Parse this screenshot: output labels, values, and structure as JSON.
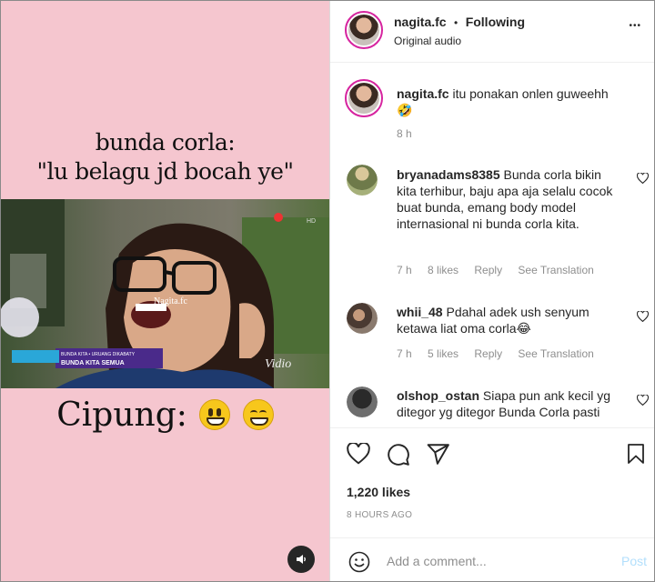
{
  "media": {
    "caption_top_line1": "bunda corla:",
    "caption_top_line2": "\"lu belagu jd bocah ye\"",
    "caption_bottom": "Cipung:",
    "watermark": "Nagita.fc",
    "vidio_logo": "Vidio",
    "banner_line1": "BUNDA KITA SEMUA",
    "channel_tag": "HD"
  },
  "header": {
    "username": "nagita.fc",
    "separator": "•",
    "follow_status": "Following",
    "audio": "Original audio",
    "more": "•••"
  },
  "comments": [
    {
      "username": "nagita.fc",
      "text": "itu ponakan onlen guweehh",
      "emoji": "🤣",
      "time": "8 h"
    },
    {
      "username": "bryanadams8385",
      "text": "Bunda corla bikin kita terhibur, baju apa aja selalu cocok buat bunda, emang body model internasional ni bunda corla kita.",
      "time": "7 h",
      "likes": "8 likes",
      "reply": "Reply",
      "translate": "See Translation"
    },
    {
      "username": "whii_48",
      "text": "Pdahal adek ush senyum ketawa liat oma corla😂",
      "time": "7 h",
      "likes": "5 likes",
      "reply": "Reply",
      "translate": "See Translation"
    },
    {
      "username": "olshop_ostan",
      "text": "Siapa pun ank kecil yg ditegor yg ditegor Bunda Corla pasti"
    }
  ],
  "actions": {
    "likes": "1,220 likes",
    "timestamp": "8 HOURS AGO"
  },
  "add_comment": {
    "placeholder": "Add a comment...",
    "post_label": "Post"
  },
  "colors": {
    "media_bg": "#f5c6cf",
    "link_blue": "#b2dffc",
    "ring": "#d6249f"
  },
  "icons": [
    "heart-icon",
    "comment-icon",
    "share-icon",
    "bookmark-icon",
    "emoji-icon",
    "sound-icon",
    "more-icon"
  ]
}
